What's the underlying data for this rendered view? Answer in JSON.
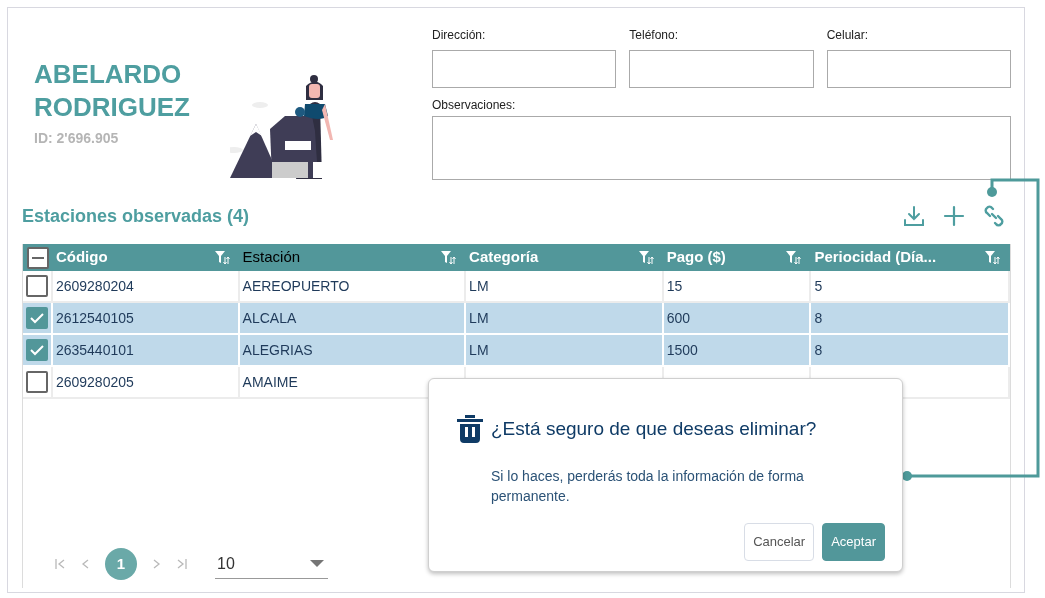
{
  "profile": {
    "name": "ABELARDO RODRIGUEZ",
    "id": "ID: 2'696.905"
  },
  "form": {
    "fields": [
      {
        "label": "Dirección:"
      },
      {
        "label": "Teléfono:"
      },
      {
        "label": "Celular:"
      }
    ],
    "notes": {
      "label": "Observaciones:"
    }
  },
  "section": {
    "title": "Estaciones observadas (4)"
  },
  "table": {
    "header_checkbox": {
      "indeterminate": true
    },
    "columns": [
      "Código",
      "Estación",
      "Categoría",
      "Pago ($)",
      "Periocidad (Día..."
    ],
    "rows": [
      {
        "selected": false,
        "cells": [
          "2609280204",
          "AEREOPUERTO",
          "LM",
          "15",
          "5"
        ]
      },
      {
        "selected": true,
        "cells": [
          "2612540105",
          "ALCALA",
          "LM",
          "600",
          "8"
        ]
      },
      {
        "selected": true,
        "cells": [
          "2635440101",
          "ALEGRIAS",
          "LM",
          "1500",
          "8"
        ]
      },
      {
        "selected": false,
        "cells": [
          "2609280205",
          "AMAIME"
        ]
      }
    ]
  },
  "pagination": {
    "pages": [
      {
        "label": "1",
        "selected": true
      }
    ],
    "page_size": "10"
  },
  "dialog": {
    "title": "¿Está seguro de que deseas eliminar?",
    "message": "Si lo haces, perderás toda la información de forma permanente.",
    "buttons": [
      {
        "label": "Cancelar",
        "kind": "secondary"
      },
      {
        "label": "Aceptar",
        "kind": "primary"
      }
    ]
  }
}
